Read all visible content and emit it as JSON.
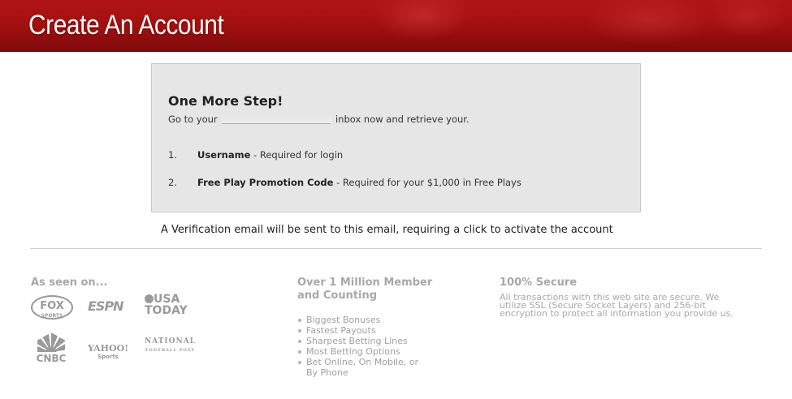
{
  "header": {
    "title": "Create An Account"
  },
  "step_box": {
    "heading": "One More Step!",
    "instruction_before": "Go to your",
    "instruction_after": "inbox now and retrieve your.",
    "items": [
      {
        "number": "1.",
        "label": "Username",
        "description": " - Required for login"
      },
      {
        "number": "2.",
        "label": "Free Play Promotion Code",
        "description": " - Required for your $1,000 in Free Plays"
      }
    ]
  },
  "verification_note": "A Verification email will be sent to this email, requiring a click to activate the account",
  "footer": {
    "seen_on": {
      "heading": "As seen on...",
      "logos": [
        "FOX SPORTS",
        "ESPN",
        "USA TODAY",
        "CNBC",
        "YAHOO! Sports",
        "NATIONAL FOOTBALL POST"
      ]
    },
    "members": {
      "heading_line1": "Over 1 Million Member",
      "heading_line2": "and Counting",
      "features": [
        "Biggest Bonuses",
        "Fastest Payouts",
        "Sharpest Betting Lines",
        "Most Betting Options",
        "Bet Online, On Mobile, or",
        "By Phone"
      ]
    },
    "secure": {
      "heading": "100% Secure",
      "text": "All transactions with this web site are secure. We utilize SSL (Secure Socket Layers) and 256-bit encryption to protect all information you provide us."
    }
  }
}
